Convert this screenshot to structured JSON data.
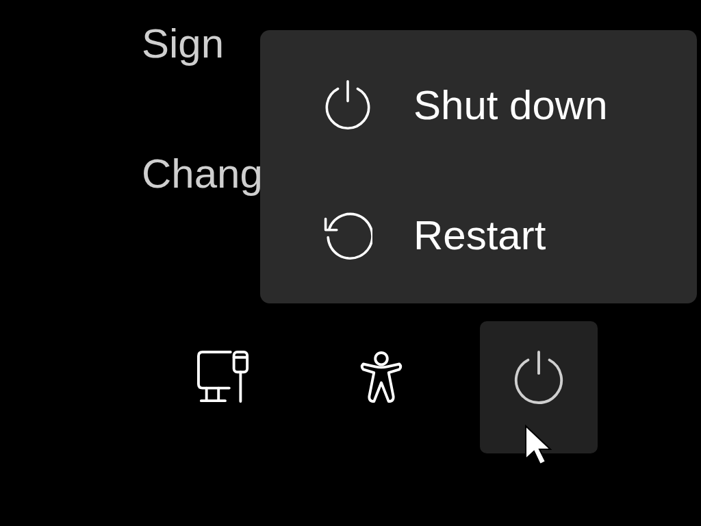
{
  "options": [
    {
      "label": "Sign"
    },
    {
      "label": "Chang"
    }
  ],
  "power_menu": {
    "items": [
      {
        "kind": "shutdown",
        "label": "Shut down"
      },
      {
        "kind": "restart",
        "label": "Restart"
      }
    ]
  },
  "bottom_buttons": [
    {
      "kind": "network",
      "selected": false
    },
    {
      "kind": "accessibility",
      "selected": false
    },
    {
      "kind": "power",
      "selected": true
    }
  ]
}
